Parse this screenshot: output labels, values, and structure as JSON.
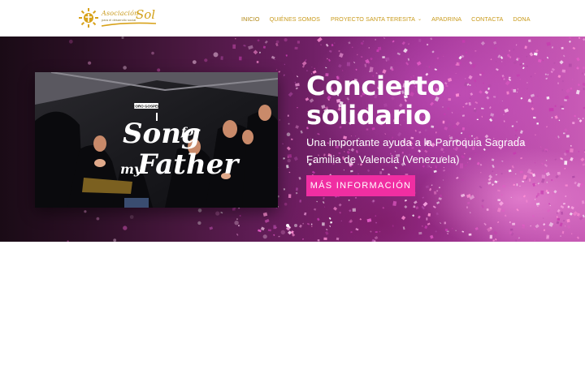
{
  "header": {
    "logo": {
      "small_text": "Asociación",
      "big_text": "Sol",
      "tagline": "para el desarrollo social",
      "icon": "sun-logo-icon"
    },
    "nav": [
      {
        "label": "INICIO",
        "active": true
      },
      {
        "label": "QUIÉNES SOMOS"
      },
      {
        "label": "PROYECTO SANTA TERESITA",
        "dropdown": true,
        "caret": "⌄"
      },
      {
        "label": "APADRINA"
      },
      {
        "label": "CONTACTA"
      },
      {
        "label": "DONA"
      }
    ]
  },
  "hero": {
    "title_line1": "Concierto",
    "title_line2": "solidario",
    "subtitle": "Una importante ayuda a la Parroquia Sagrada Familia de Valencia (Venezuela)",
    "button_label": "MÁS INFORMACIÓN",
    "photo": {
      "badge": "CORO GOSPEL",
      "line1": "Song",
      "line2": "for",
      "line3": "my",
      "line4": "Father"
    },
    "slider": {
      "slides": 2,
      "active": 1
    }
  },
  "colors": {
    "nav_text": "#c99a1a",
    "button_bg": "#f02ea2",
    "hero_white": "#ffffff"
  }
}
